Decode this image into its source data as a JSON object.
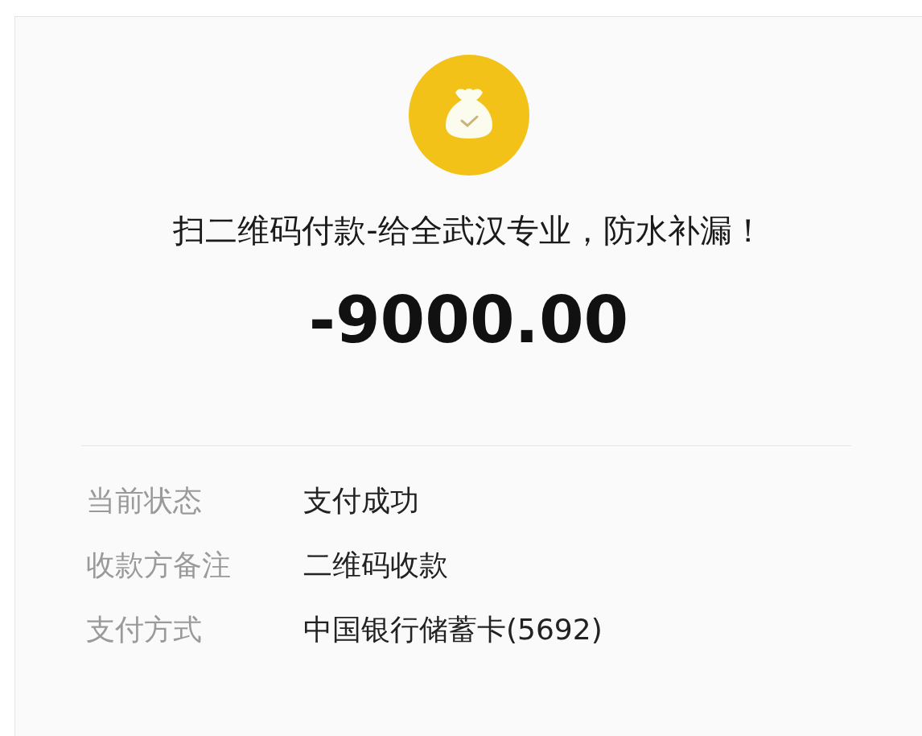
{
  "payee_title": "扫二维码付款-给全武汉专业，防水补漏！",
  "amount": "-9000.00",
  "details": [
    {
      "label": "当前状态",
      "value": "支付成功"
    },
    {
      "label": "收款方备注",
      "value": "二维码收款"
    },
    {
      "label": "支付方式",
      "value": "中国银行储蓄卡(5692)"
    }
  ]
}
